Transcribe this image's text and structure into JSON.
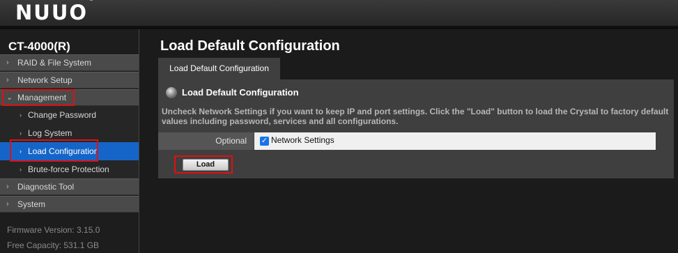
{
  "header": {
    "logo": "NUUO",
    "logo_mark": "®"
  },
  "sidebar": {
    "device_name": "CT-4000(R)",
    "items": [
      {
        "label": "RAID & File System"
      },
      {
        "label": "Network Setup"
      },
      {
        "label": "Management"
      },
      {
        "label": "Diagnostic Tool"
      },
      {
        "label": "System"
      }
    ],
    "management_subitems": [
      {
        "label": "Change Password"
      },
      {
        "label": "Log System"
      },
      {
        "label": "Load Configuration"
      },
      {
        "label": "Brute-force Protection"
      }
    ],
    "firmware": "Firmware Version: 3.15.0",
    "capacity": "Free Capacity: 531.1 GB"
  },
  "main": {
    "page_title": "Load Default Configuration",
    "tab_label": "Load Default Configuration",
    "section_title": "Load Default Configuration",
    "description": "Uncheck Network Settings if you want to keep IP and port settings. Click the \"Load\" button to load the Crystal to factory default values including password, services and all configurations.",
    "optional_label": "Optional",
    "network_settings_label": "Network Settings",
    "network_settings_checked": true,
    "load_button": "Load"
  },
  "colors": {
    "active_item": "#1565c8",
    "highlight_box": "#e01010"
  }
}
